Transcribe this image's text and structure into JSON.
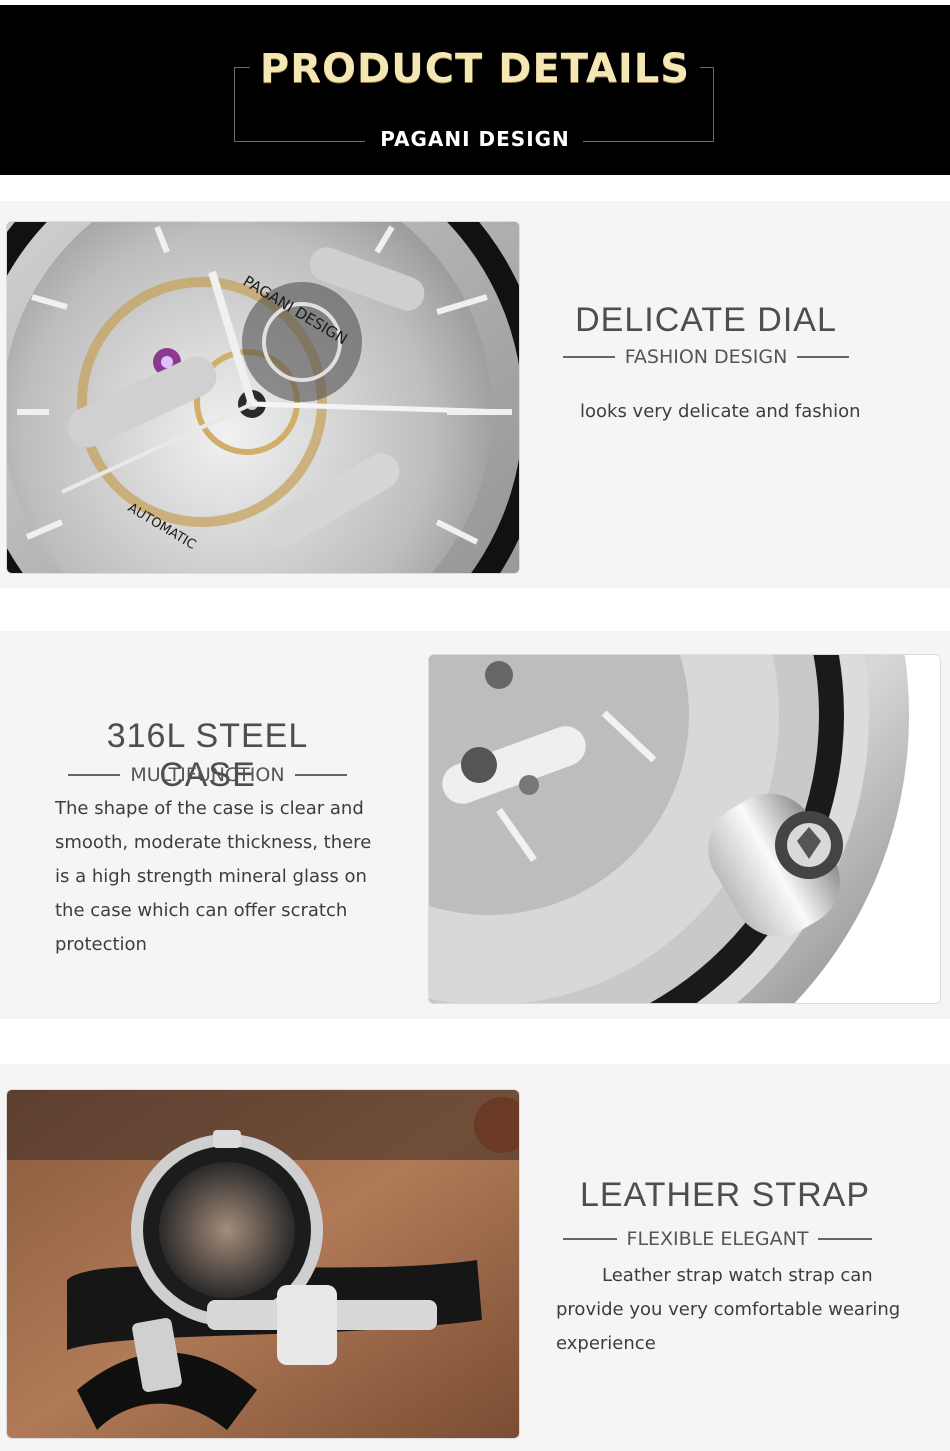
{
  "banner": {
    "title": "PRODUCT DETAILS",
    "subtitle": "PAGANI DESIGN"
  },
  "dial": {
    "heading": "DELICATE DIAL",
    "subheading": "FASHION DESIGN",
    "description": "looks very delicate and fashion",
    "image_text": {
      "brand": "PAGANI DESIGN",
      "label": "AUTOMATIC"
    }
  },
  "case": {
    "heading": "316L STEEL CASE",
    "subheading": "MULTIFUNCTION",
    "lines": [
      "The shape of the case is clear and",
      "smooth, moderate thickness, there",
      "is a high strength mineral glass on",
      "the case which can offer scratch",
      "protection"
    ]
  },
  "strap": {
    "heading": "LEATHER STRAP",
    "subheading": "FLEXIBLE ELEGANT",
    "lines": [
      "Leather strap watch strap can",
      "provide you very comfortable wearing",
      "experience"
    ]
  },
  "colors": {
    "banner_bg": "#000000",
    "title_gold": "#f4e7b4",
    "section_bg": "#f5f5f5",
    "heading_text": "#4e4e4e"
  }
}
